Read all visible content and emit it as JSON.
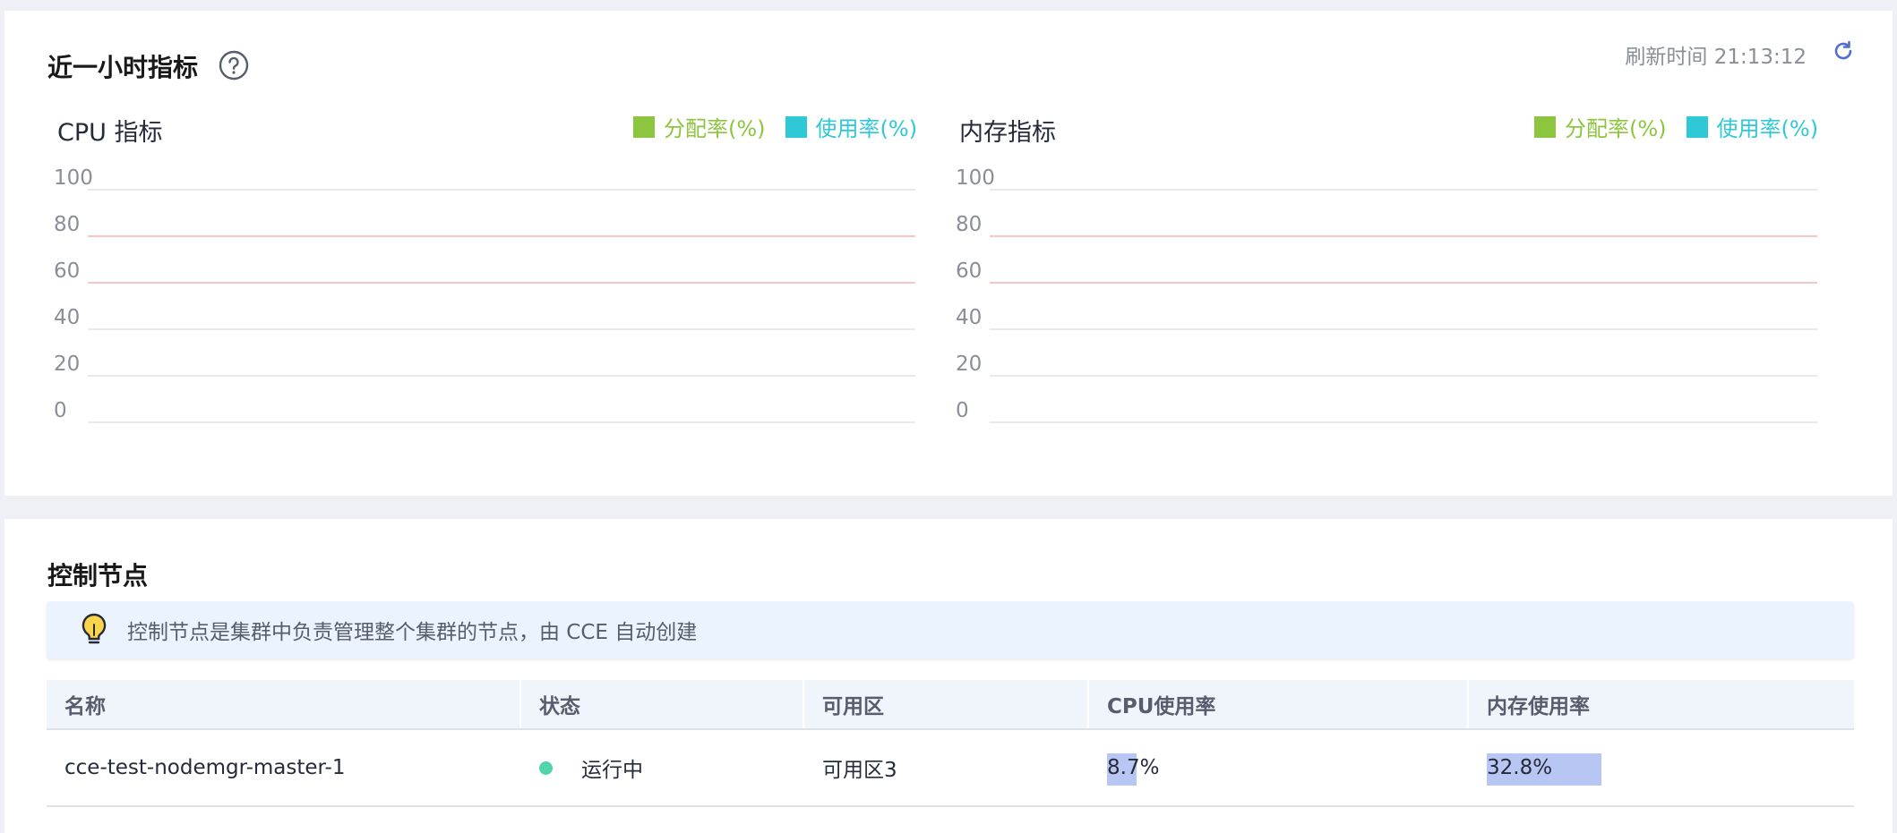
{
  "metrics": {
    "title": "近一小时指标",
    "refresh_label": "刷新时间 21:13:12"
  },
  "chart_data": [
    {
      "type": "line",
      "title": "CPU 指标",
      "yticks": [
        "100",
        "80",
        "60",
        "40",
        "20",
        "0"
      ],
      "ylim": [
        0,
        100
      ],
      "threshold_lines": [
        80,
        60
      ],
      "series": [
        {
          "name": "分配率(%)",
          "color": "#8cc63f",
          "values": []
        },
        {
          "name": "使用率(%)",
          "color": "#2ec8d6",
          "values": []
        }
      ],
      "grid": true,
      "legend": "top-right"
    },
    {
      "type": "line",
      "title": "内存指标",
      "yticks": [
        "100",
        "80",
        "60",
        "40",
        "20",
        "0"
      ],
      "ylim": [
        0,
        100
      ],
      "threshold_lines": [
        80,
        60
      ],
      "series": [
        {
          "name": "分配率(%)",
          "color": "#8cc63f",
          "values": []
        },
        {
          "name": "使用率(%)",
          "color": "#2ec8d6",
          "values": []
        }
      ],
      "grid": true,
      "legend": "top-right"
    }
  ],
  "nodes": {
    "title": "控制节点",
    "notice": "控制节点是集群中负责管理整个集群的节点，由 CCE 自动创建",
    "columns": [
      "名称",
      "状态",
      "可用区",
      "CPU使用率",
      "内存使用率"
    ],
    "rows": [
      {
        "name": "cce-test-nodemgr-master-1",
        "status": "运行中",
        "zone": "可用区3",
        "cpu": "8.7%",
        "cpu_fraction": 0.087,
        "mem": "32.8%",
        "mem_fraction": 0.328
      }
    ]
  },
  "colors": {
    "accent": "#526ecc",
    "grid": "#e8eaf0",
    "threshold": "#f6c6c2",
    "status_running": "#50d4ab",
    "usage_bar": "#b8c6f4"
  }
}
